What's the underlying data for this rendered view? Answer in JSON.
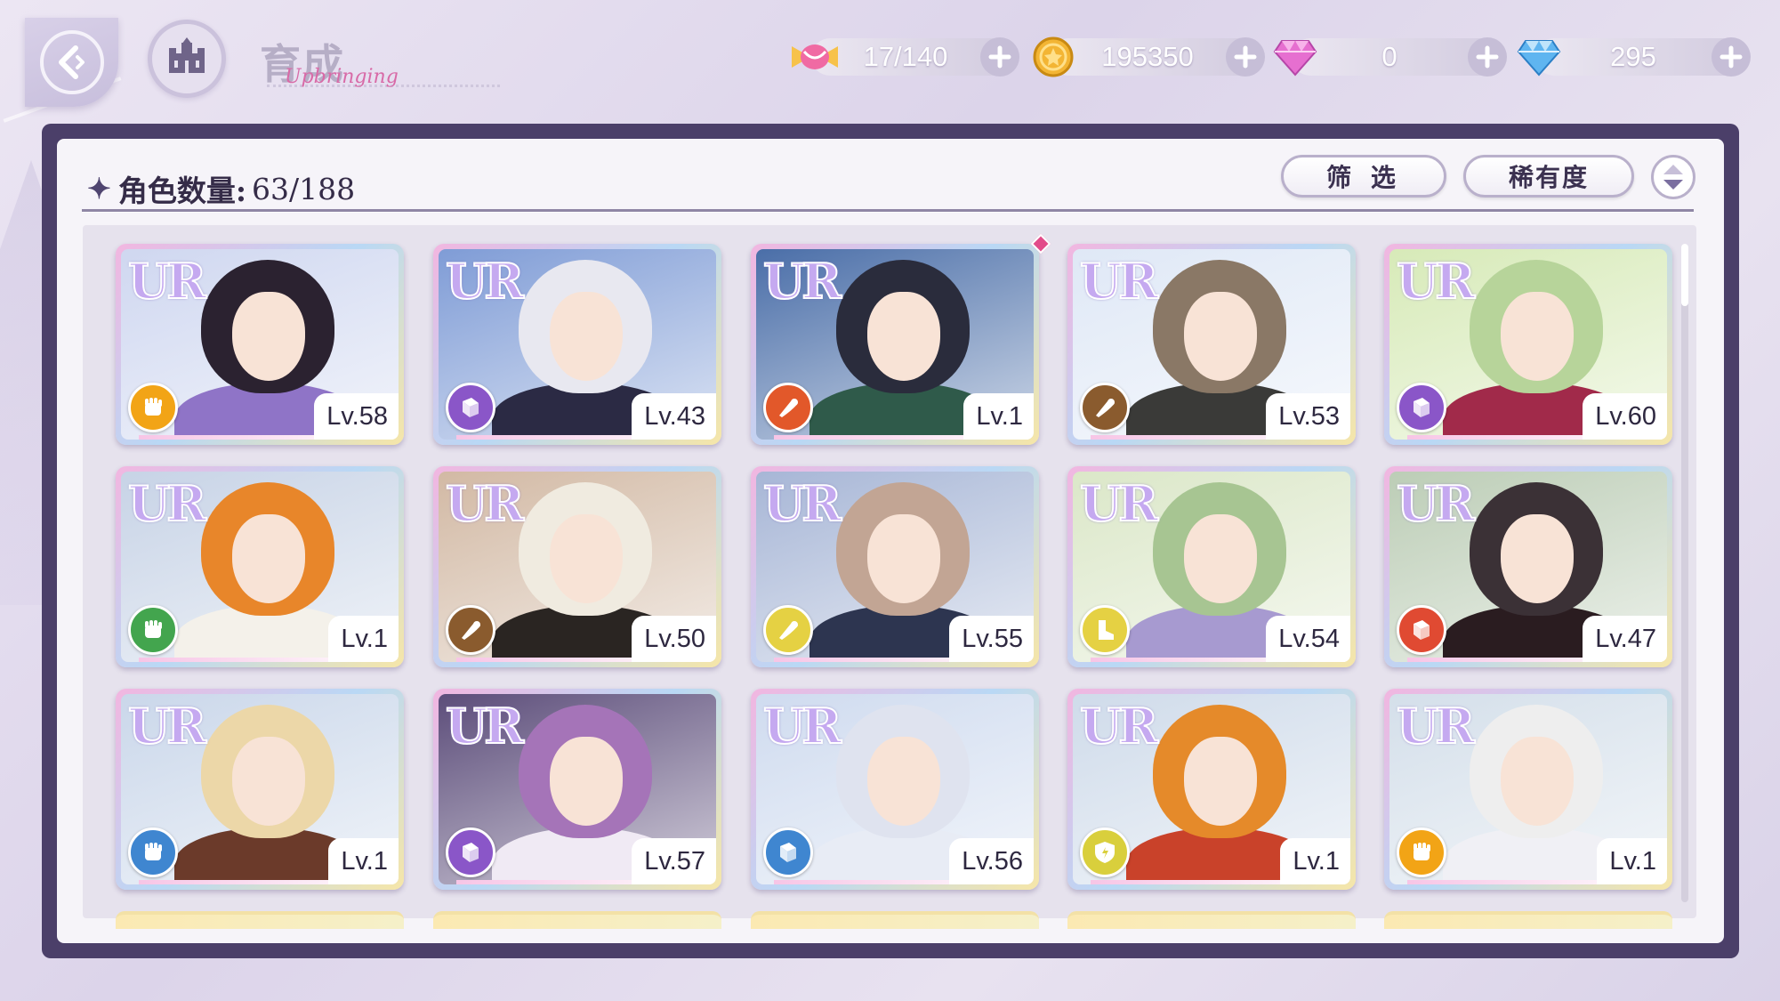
{
  "header": {
    "title": "育成",
    "title_script": "Upbringing"
  },
  "resources": [
    {
      "name": "candy",
      "icon": "candy-icon",
      "value": "17/140",
      "color": "#f06aa3"
    },
    {
      "name": "coin",
      "icon": "coin-icon",
      "value": "195350",
      "color": "#f3b534"
    },
    {
      "name": "pink-gem",
      "icon": "pink-gem-icon",
      "value": "0",
      "color": "#e66fd0"
    },
    {
      "name": "blue-gem",
      "icon": "blue-gem-icon",
      "value": "295",
      "color": "#5fb5f0"
    }
  ],
  "roster": {
    "count_label": "角色数量:",
    "count_value": "63/188",
    "filter_label": "筛 选",
    "rarity_label": "稀有度"
  },
  "cards": [
    {
      "rarity": "UR",
      "level": "Lv.58",
      "attr_color": "#f2a416",
      "attr_icon": "fist-icon",
      "hair": "#2b2230",
      "sky": "#cfd7f0",
      "outfit": "#8f74c7",
      "new": false
    },
    {
      "rarity": "UR",
      "level": "Lv.43",
      "attr_color": "#8a56c8",
      "attr_icon": "book-icon",
      "hair": "#e8e8f0",
      "sky": "#7f9cd6",
      "outfit": "#2b2a44",
      "new": false
    },
    {
      "rarity": "UR",
      "level": "Lv.1",
      "attr_color": "#e2582a",
      "attr_icon": "horn-icon",
      "hair": "#2a2c3c",
      "sky": "#4a6ea8",
      "outfit": "#2f5a4a",
      "new": true
    },
    {
      "rarity": "UR",
      "level": "Lv.53",
      "attr_color": "#8a5b2e",
      "attr_icon": "horn-icon",
      "hair": "#8a7866",
      "sky": "#dfe8f6",
      "outfit": "#3a3a38",
      "new": false
    },
    {
      "rarity": "UR",
      "level": "Lv.60",
      "attr_color": "#8a56c8",
      "attr_icon": "book-icon",
      "hair": "#b7d49a",
      "sky": "#d7eab8",
      "outfit": "#a12a4a",
      "new": false
    },
    {
      "rarity": "UR",
      "level": "Lv.1",
      "attr_color": "#43a54e",
      "attr_icon": "fist-icon",
      "hair": "#e8862a",
      "sky": "#c7d3e6",
      "outfit": "#f4f1ea",
      "new": false
    },
    {
      "rarity": "UR",
      "level": "Lv.50",
      "attr_color": "#8a5b2e",
      "attr_icon": "horn-icon",
      "hair": "#f0ebe0",
      "sky": "#d2b9a4",
      "outfit": "#2a2522",
      "new": false
    },
    {
      "rarity": "UR",
      "level": "Lv.55",
      "attr_color": "#e5d143",
      "attr_icon": "horn-icon",
      "hair": "#c2a594",
      "sky": "#a7b6d6",
      "outfit": "#2d3550",
      "new": false
    },
    {
      "rarity": "UR",
      "level": "Lv.54",
      "attr_color": "#e5d143",
      "attr_icon": "boot-icon",
      "hair": "#a7c592",
      "sky": "#dbe7c8",
      "outfit": "#a79ad0",
      "new": false
    },
    {
      "rarity": "UR",
      "level": "Lv.47",
      "attr_color": "#e04a32",
      "attr_icon": "book-icon",
      "hair": "#3b3136",
      "sky": "#bccdb6",
      "outfit": "#2a1c20",
      "new": false
    },
    {
      "rarity": "UR",
      "level": "Lv.1",
      "attr_color": "#3f86d0",
      "attr_icon": "fist-icon",
      "hair": "#ecd7a8",
      "sky": "#cad7ea",
      "outfit": "#6b3a2a",
      "new": false
    },
    {
      "rarity": "UR",
      "level": "Lv.57",
      "attr_color": "#8a56c8",
      "attr_icon": "book-icon",
      "hair": "#a574b8",
      "sky": "#5c4d7a",
      "outfit": "#f0eaf4",
      "new": false
    },
    {
      "rarity": "UR",
      "level": "Lv.56",
      "attr_color": "#3f86d0",
      "attr_icon": "book-icon",
      "hair": "#dfe3ef",
      "sky": "#cfdbef",
      "outfit": "#e8ecf5",
      "new": false
    },
    {
      "rarity": "UR",
      "level": "Lv.1",
      "attr_color": "#d9cf3c",
      "attr_icon": "shield-icon",
      "hair": "#e58a2a",
      "sky": "#cfdbea",
      "outfit": "#c9422a",
      "new": false
    },
    {
      "rarity": "UR",
      "level": "Lv.1",
      "attr_color": "#f2a416",
      "attr_icon": "fist-icon",
      "hair": "#eeeeee",
      "sky": "#d4dfea",
      "outfit": "#f0f0f5",
      "new": false
    }
  ]
}
